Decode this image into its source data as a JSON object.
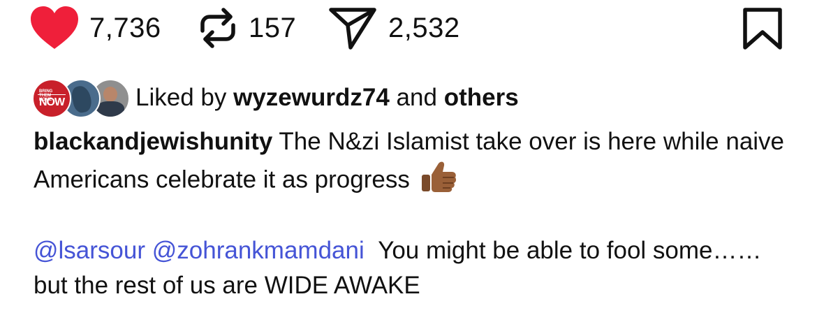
{
  "actions": {
    "likes_count": "7,736",
    "reposts_count": "157",
    "shares_count": "2,532",
    "like_color": "#ef1f3a"
  },
  "liked_by": {
    "prefix": "Liked by",
    "user": "wyzewurdz74",
    "connector": "and",
    "others": "others",
    "avatar1_text_small": "BRING THEM HOME",
    "avatar1_text_big": "NOW"
  },
  "caption": {
    "username": "blackandjewishunity",
    "text": "The N&zi Islamist take over is here while naive Americans celebrate it as progress",
    "emoji": "thumbs-up-icon"
  },
  "comment": {
    "mention1": "@lsarsour",
    "mention2": "@zohrankmamdani",
    "text": "You might be able to fool some……but the rest of us are WIDE AWAKE",
    "mention_color": "#4554d6"
  }
}
